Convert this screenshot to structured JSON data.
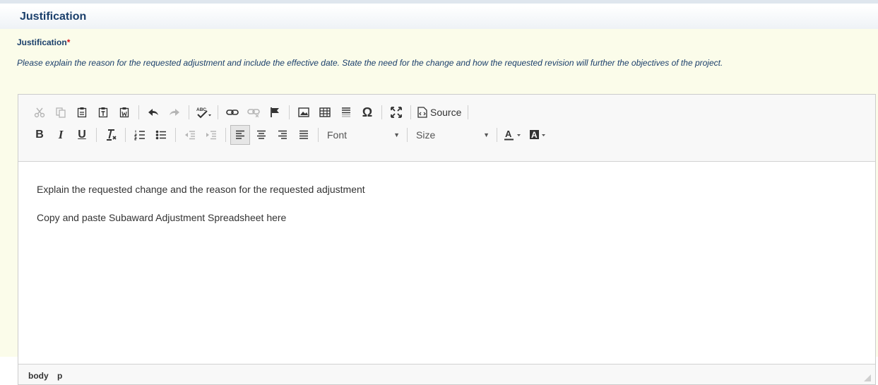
{
  "section": {
    "title": "Justification"
  },
  "field": {
    "label": "Justification",
    "required_marker": "*",
    "help": "Please explain the reason for the requested adjustment and include the effective date. State the need for the change and how the requested revision will further the objectives of the project."
  },
  "toolbar": {
    "source_label": "Source",
    "font_label": "Font",
    "size_label": "Size",
    "spell_icon_text": "ABC",
    "text_color_letter": "A",
    "bg_color_letter": "A",
    "bold_letter": "B",
    "italic_letter": "I",
    "underline_letter": "U"
  },
  "content": {
    "paragraphs": [
      "Explain the requested change and the reason for the requested adjustment",
      "Copy and paste Subaward Adjustment Spreadsheet here"
    ]
  },
  "elements_path": [
    "body",
    "p"
  ],
  "colors": {
    "header_text": "#1b3f6b",
    "required": "#d4141a",
    "field_bg": "#fbfcea"
  }
}
